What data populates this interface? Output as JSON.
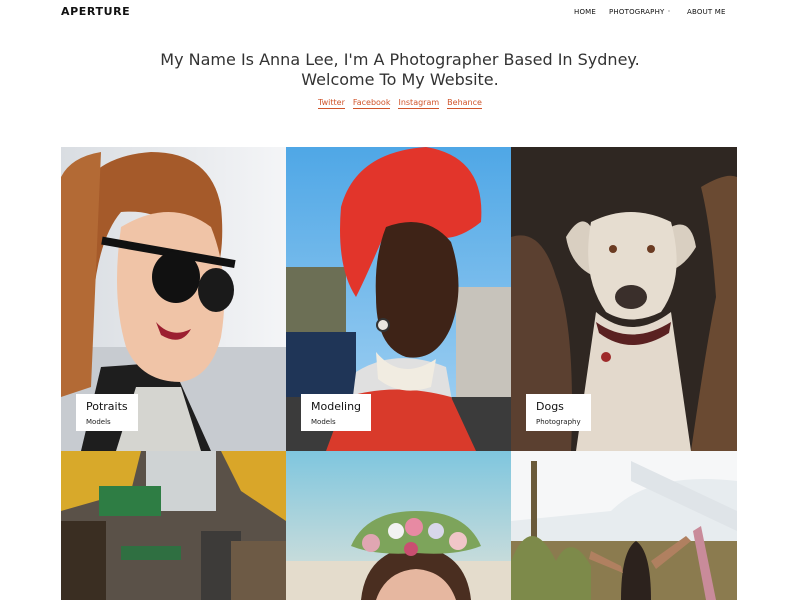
{
  "brand": "APERTURE",
  "nav": {
    "items": [
      "HOME",
      "PHOTOGRAPHY",
      "ABOUT ME"
    ]
  },
  "hero": {
    "line1": "My Name Is Anna Lee, I'm A Photographer Based In Sydney.",
    "line2": "Welcome To My Website."
  },
  "social": [
    "Twitter",
    "Facebook",
    "Instagram",
    "Behance"
  ],
  "gallery": [
    {
      "title": "Potraits",
      "category": "Models"
    },
    {
      "title": "Modeling",
      "category": "Models"
    },
    {
      "title": "Dogs",
      "category": "Photography"
    }
  ],
  "colors": {
    "accent": "#d0542a",
    "text": "#333333"
  }
}
